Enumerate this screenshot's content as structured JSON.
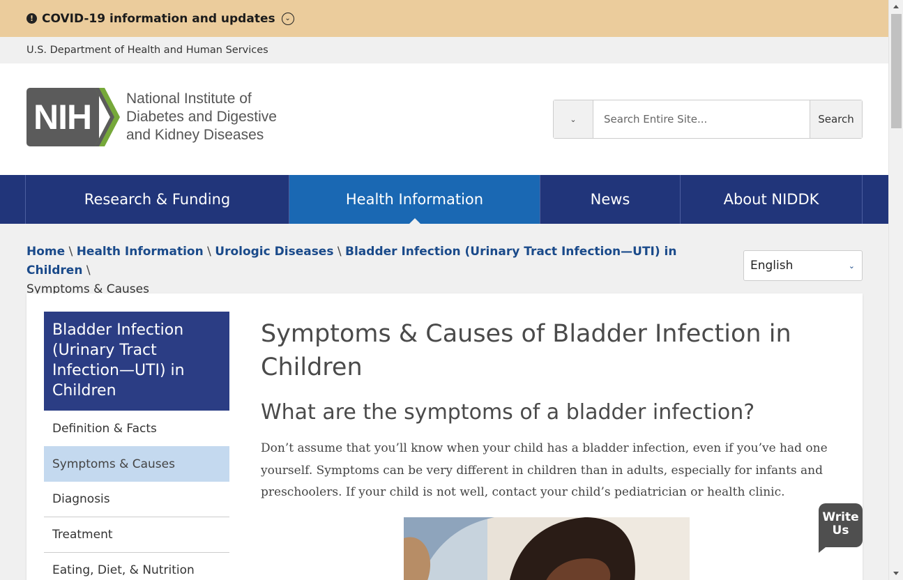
{
  "covid_banner": {
    "text": "COVID-19 information and updates",
    "icon": "alert-icon",
    "toggle_icon": "chevron-down-circle-icon"
  },
  "hhs_bar": {
    "text": "U.S. Department of Health and Human Services"
  },
  "logo": {
    "letters": "NIH",
    "lines": [
      "National Institute of",
      "Diabetes and Digestive",
      "and Kidney Diseases"
    ],
    "colors": {
      "grey": "#5b5b5b",
      "green": "#76a83a"
    }
  },
  "search": {
    "placeholder": "Search Entire Site...",
    "button_label": "Search",
    "scope_icon": "chevron-down-icon"
  },
  "nav": {
    "items": [
      {
        "label": "Research & Funding",
        "active": false
      },
      {
        "label": "Health Information",
        "active": true
      },
      {
        "label": "News",
        "active": false
      },
      {
        "label": "About NIDDK",
        "active": false
      }
    ],
    "colors": {
      "bar": "#21357a",
      "active": "#1a68b3"
    }
  },
  "breadcrumb": {
    "links": [
      "Home",
      "Health Information",
      "Urologic Diseases",
      "Bladder Infection (Urinary Tract Infection—UTI) in Children"
    ],
    "separator": "\\",
    "current": "Symptoms & Causes"
  },
  "language_select": {
    "selected": "English"
  },
  "sidenav": {
    "title": "Bladder Infection (Urinary Tract Infection—UTI) in Children",
    "items": [
      {
        "label": "Definition & Facts",
        "active": false
      },
      {
        "label": "Symptoms & Causes",
        "active": true
      },
      {
        "label": "Diagnosis",
        "active": false
      },
      {
        "label": "Treatment",
        "active": false
      },
      {
        "label": "Eating, Diet, & Nutrition",
        "active": false
      }
    ]
  },
  "article": {
    "title": "Symptoms & Causes of Bladder Infection in Children",
    "subheading": "What are the symptoms of a bladder infection?",
    "paragraph": "Don’t assume that you’ll know when your child has a bladder infection, even if you’ve had one yourself. Symptoms can be very different in children than in adults, especially for infants and preschoolers. If your child is not well, contact your child’s pediatrician or health clinic."
  },
  "write_us": {
    "line1": "Write",
    "line2": "Us"
  }
}
